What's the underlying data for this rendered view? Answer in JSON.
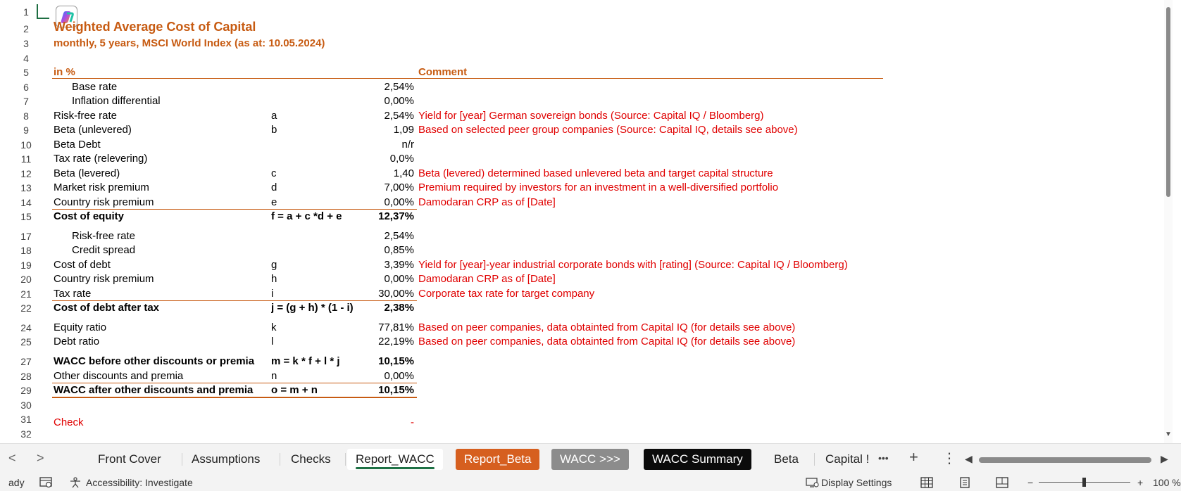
{
  "sheet": {
    "title": "Weighted Average Cost of Capital",
    "subtitle": "monthly, 5 years, MSCI World Index (as at: 10.05.2024)",
    "header": {
      "unit": "in %",
      "comment": "Comment"
    },
    "row_numbers": [
      "1",
      "2",
      "3",
      "4",
      "5",
      "6",
      "7",
      "8",
      "9",
      "10",
      "11",
      "12",
      "13",
      "14",
      "15",
      "17",
      "18",
      "19",
      "20",
      "21",
      "22",
      "24",
      "25",
      "27",
      "28",
      "29",
      "30",
      "31",
      "32"
    ],
    "rows": [
      {
        "row": "6",
        "label": "Base rate",
        "sym": "",
        "value": "2,54%",
        "comment": ""
      },
      {
        "row": "7",
        "label": "Inflation differential",
        "sym": "",
        "value": "0,00%",
        "comment": ""
      },
      {
        "row": "8",
        "label": "Risk-free rate",
        "sym": "a",
        "value": "2,54%",
        "comment": "Yield for [year] German sovereign bonds (Source: Capital IQ / Bloomberg)"
      },
      {
        "row": "9",
        "label": "Beta (unlevered)",
        "sym": "b",
        "value": "1,09",
        "comment": "Based on selected peer group companies (Source: Capital IQ, details see above)"
      },
      {
        "row": "10",
        "label": "Beta Debt",
        "sym": "",
        "value": "n/r",
        "comment": ""
      },
      {
        "row": "11",
        "label": "Tax rate (relevering)",
        "sym": "",
        "value": "0,0%",
        "comment": ""
      },
      {
        "row": "12",
        "label": "Beta (levered)",
        "sym": "c",
        "value": "1,40",
        "comment": "Beta (levered) determined based unlevered beta and target capital structure"
      },
      {
        "row": "13",
        "label": "Market risk premium",
        "sym": "d",
        "value": "7,00%",
        "comment": "Premium required by investors for an investment in a well-diversified portfolio"
      },
      {
        "row": "14",
        "label": "Country risk premium",
        "sym": "e",
        "value": "0,00%",
        "comment": "Damodaran CRP as of [Date]"
      },
      {
        "row": "15",
        "label": "Cost of equity",
        "sym": "f = a + c *d + e",
        "value": "12,37%",
        "comment": ""
      },
      {
        "row": "17",
        "label": "Risk-free rate",
        "sym": "",
        "value": "2,54%",
        "comment": ""
      },
      {
        "row": "18",
        "label": "Credit spread",
        "sym": "",
        "value": "0,85%",
        "comment": ""
      },
      {
        "row": "19",
        "label": "Cost of debt",
        "sym": "g",
        "value": "3,39%",
        "comment": "Yield for [year]-year industrial corporate bonds with [rating] (Source: Capital IQ / Bloomberg)"
      },
      {
        "row": "20",
        "label": "Country risk premium",
        "sym": "h",
        "value": "0,00%",
        "comment": "Damodaran CRP as of [Date]"
      },
      {
        "row": "21",
        "label": "Tax rate",
        "sym": "i",
        "value": "30,00%",
        "comment": "Corporate tax rate for target company"
      },
      {
        "row": "22",
        "label": "Cost of debt after tax",
        "sym": "j = (g + h) * (1 - i)",
        "value": "2,38%",
        "comment": ""
      },
      {
        "row": "24",
        "label": "Equity ratio",
        "sym": "k",
        "value": "77,81%",
        "comment": "Based on peer companies, data obtainted from Capital IQ (for details see above)"
      },
      {
        "row": "25",
        "label": "Debt ratio",
        "sym": "l",
        "value": "22,19%",
        "comment": "Based on peer companies, data obtainted from Capital IQ (for details see above)"
      },
      {
        "row": "27",
        "label": "WACC before other discounts or premia",
        "sym": "m = k * f + l * j",
        "value": "10,15%",
        "comment": ""
      },
      {
        "row": "28",
        "label": "Other discounts and premia",
        "sym": "n",
        "value": "0,00%",
        "comment": ""
      },
      {
        "row": "29",
        "label": "WACC after other discounts and premia",
        "sym": "o = m + n",
        "value": "10,15%",
        "comment": ""
      }
    ],
    "check": {
      "label": "Check",
      "value": "-"
    }
  },
  "tabs": {
    "prev": "<",
    "next": ">",
    "items": [
      "Front Cover",
      "Assumptions",
      "Checks",
      "Report_WACC",
      "Report_Beta",
      "WACC >>>",
      "WACC Summary",
      "Beta",
      "Capital !"
    ],
    "more": "•••",
    "add": "+",
    "menu": "⋮"
  },
  "status": {
    "ready": "ady",
    "accessibility": "Accessibility: Investigate",
    "display_settings": "Display Settings",
    "zoom_minus": "−",
    "zoom_plus": "+",
    "zoom": "100 %"
  },
  "colors": {
    "accent": "#c75b12",
    "comment_red": "#e00000",
    "selected_tab": "#1e7145",
    "report_beta_tab": "#d65f1f",
    "wacc_tab": "#8c8c8c",
    "summary_tab": "#0b0b0b"
  },
  "icons": [
    "copilot-icon",
    "accessibility-icon",
    "display-settings-icon",
    "normal-view-icon",
    "page-layout-icon",
    "page-break-icon",
    "cell-mode-icon"
  ]
}
